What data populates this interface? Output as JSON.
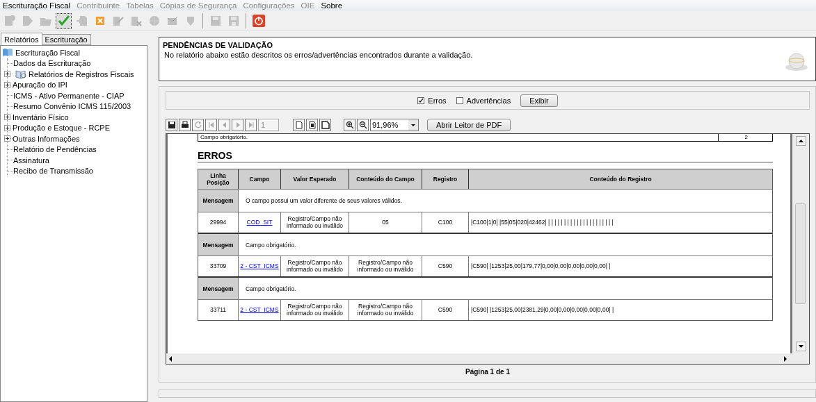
{
  "menu": [
    {
      "label": "Escrituração Fiscal",
      "disabled": false
    },
    {
      "label": "Contribuinte",
      "disabled": true
    },
    {
      "label": "Tabelas",
      "disabled": true
    },
    {
      "label": "Cópias de Segurança",
      "disabled": true
    },
    {
      "label": "Configurações",
      "disabled": true
    },
    {
      "label": "OIE",
      "disabled": true
    },
    {
      "label": "Sobre",
      "disabled": false
    }
  ],
  "toolbar": [
    {
      "kind": "new-doc",
      "disabled": true,
      "selected": false
    },
    {
      "kind": "doc-arrow",
      "disabled": true,
      "selected": false
    },
    {
      "kind": "folder",
      "disabled": true,
      "selected": false
    },
    {
      "kind": "check",
      "disabled": false,
      "selected": true
    },
    {
      "kind": "import",
      "disabled": true,
      "selected": false
    },
    {
      "kind": "cancel",
      "disabled": false,
      "selected": false
    },
    {
      "kind": "sign",
      "disabled": true,
      "selected": false
    },
    {
      "kind": "sign-x",
      "disabled": true,
      "selected": false
    },
    {
      "kind": "globe",
      "disabled": true,
      "selected": false
    },
    {
      "kind": "mail",
      "disabled": true,
      "selected": false
    },
    {
      "kind": "shield",
      "disabled": true,
      "selected": false
    },
    {
      "kind": "separator"
    },
    {
      "kind": "save",
      "disabled": true,
      "selected": false
    },
    {
      "kind": "save-as",
      "disabled": true,
      "selected": false
    },
    {
      "kind": "separator"
    },
    {
      "kind": "power",
      "disabled": false,
      "selected": false
    }
  ],
  "left_tabs": [
    {
      "label": "Relatórios",
      "selected": true
    },
    {
      "label": "Escrituração",
      "selected": false
    }
  ],
  "tree": {
    "label": "Escrituração Fiscal",
    "children": [
      {
        "label": "Dados da Escrituração",
        "kind": "leaf"
      },
      {
        "label": "Relatórios de Registros Fiscais",
        "kind": "report-group",
        "expanded": false
      },
      {
        "label": "Apuração do IPI",
        "kind": "group",
        "expanded": false
      },
      {
        "label": "ICMS - Ativo Permanente - CIAP",
        "kind": "leaf"
      },
      {
        "label": "Resumo  Convênio ICMS 115/2003",
        "kind": "leaf"
      },
      {
        "label": "Inventário Físico",
        "kind": "group",
        "expanded": false
      },
      {
        "label": "Produção e Estoque - RCPE",
        "kind": "group",
        "expanded": false
      },
      {
        "label": "Outras Informações",
        "kind": "group",
        "expanded": false
      },
      {
        "label": "Relatório de Pendências",
        "kind": "leaf"
      },
      {
        "label": "Assinatura",
        "kind": "leaf"
      },
      {
        "label": "Recibo de Transmissão",
        "kind": "leaf"
      }
    ]
  },
  "header": {
    "title": "PENDÊNCIAS DE VALIDAÇÃO",
    "text": "No relatório abaixo estão descritos os erros/advertências encontrados durante a validação."
  },
  "filters": [
    {
      "label": "Erros",
      "checked": true
    },
    {
      "label": "Advertências",
      "checked": false
    }
  ],
  "show_button": "Exibir",
  "report_toolbar": {
    "buttons": [
      {
        "kind": "save",
        "disabled": false
      },
      {
        "kind": "print",
        "disabled": false
      },
      {
        "kind": "refresh",
        "disabled": true
      },
      {
        "kind": "first",
        "disabled": true
      },
      {
        "kind": "prev",
        "disabled": true
      },
      {
        "kind": "next",
        "disabled": true
      },
      {
        "kind": "last",
        "disabled": true
      }
    ],
    "page": "1",
    "view_buttons": [
      {
        "kind": "page-single"
      },
      {
        "kind": "page-fit"
      },
      {
        "kind": "page-width"
      },
      {
        "kind": "zoom-in"
      },
      {
        "kind": "zoom-out"
      }
    ],
    "zoom": "91,96%",
    "pdf_button": "Abrir Leitor de PDF"
  },
  "report": {
    "previous_row": {
      "column_1": "Campo obrigatório.",
      "column_2": "2"
    },
    "section_title": "ERROS",
    "columns": [
      "Linha Posição",
      "Campo",
      "Valor Esperado",
      "Conteúdo do Campo",
      "Registro",
      "Conteúdo do Registro"
    ],
    "groups": [
      {
        "message_label": "Mensagem",
        "message": "O campo possui um valor diferente de seus valores válidos.",
        "row": {
          "line": "29994",
          "field": "COD_SIT",
          "expected": "Registro/Campo não informado ou inválido",
          "content": "05",
          "record": "C100",
          "record_content": "|C100|1|0| |55|05|020|42462| | | | | | | | | | | | | | | | | | | | | |"
        }
      },
      {
        "message_label": "Mensagem",
        "message": "Campo obrigatório.",
        "row": {
          "line": "33709",
          "field": "2 - CST_ICMS",
          "expected": "Registro/Campo não informado ou inválido",
          "content": "Registro/Campo não informado ou inválido",
          "record": "C590",
          "record_content": "|C590| |1253|25,00|179,77|0,00|0,00|0,00|0,00|0,00| |"
        }
      },
      {
        "message_label": "Mensagem",
        "message": "Campo obrigatório.",
        "row": {
          "line": "33711",
          "field": "2 - CST_ICMS",
          "expected": "Registro/Campo não informado ou inválido",
          "content": "Registro/Campo não informado ou inválido",
          "record": "C590",
          "record_content": "|C590| |1253|25,00|2381,29|0,00|0,00|0,00|0,00|0,00| |"
        }
      }
    ]
  },
  "page_indicator": "Página 1 de 1"
}
